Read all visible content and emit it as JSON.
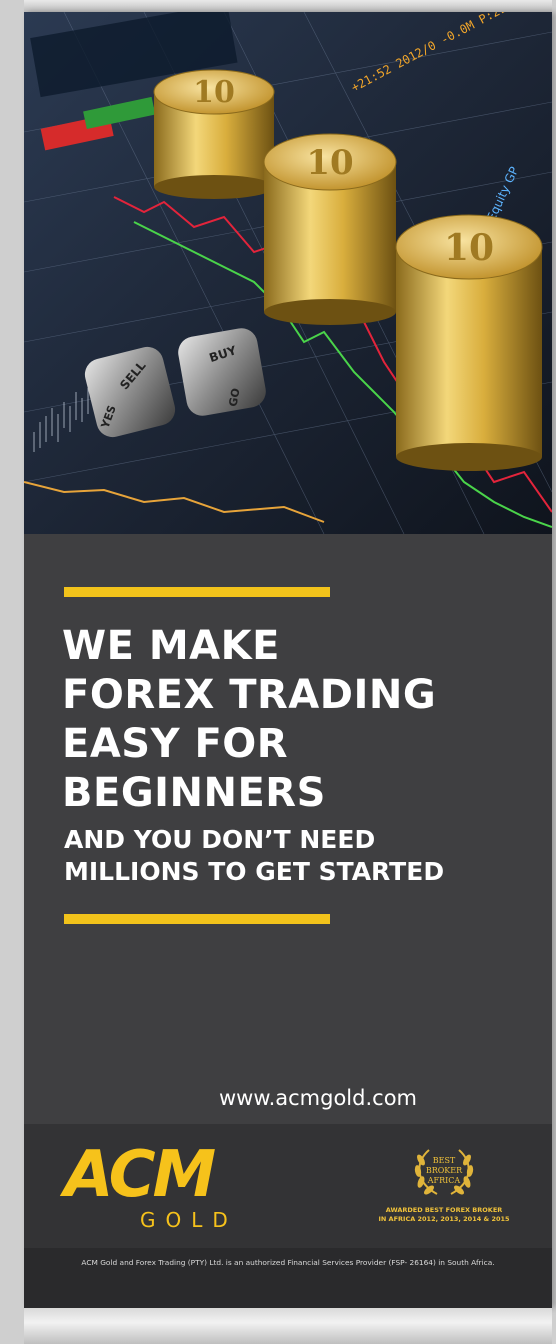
{
  "photo": {
    "dice_labels": [
      "SELL",
      "BUY",
      "YES",
      "GO"
    ],
    "coin_labels": [
      "10",
      "10",
      "10"
    ]
  },
  "headline": {
    "lines": [
      "WE MAKE",
      "FOREX TRADING",
      "EASY FOR",
      "BEGINNERS"
    ]
  },
  "subline": {
    "lines": [
      "AND YOU DON’T NEED",
      "MILLIONS TO GET STARTED"
    ]
  },
  "website": "www.acmgold.com",
  "logo": {
    "brand": "ACM",
    "sub": "GOLD"
  },
  "award": {
    "title_lines": [
      "BEST",
      "BROKER",
      "AFRICA"
    ],
    "caption_lines": [
      "AWARDED BEST FOREX BROKER",
      "IN AFRICA 2012, 2013, 2014 & 2015"
    ]
  },
  "legal": "ACM Gold and Forex Trading (PTY) Ltd. is an authorized Financial Services Provider (FSP- 26164) in South Africa.",
  "colors": {
    "accent": "#f2c31b",
    "panel": "#3f3f41",
    "logo_band": "#333335",
    "legal_band": "#2a2a2c"
  }
}
